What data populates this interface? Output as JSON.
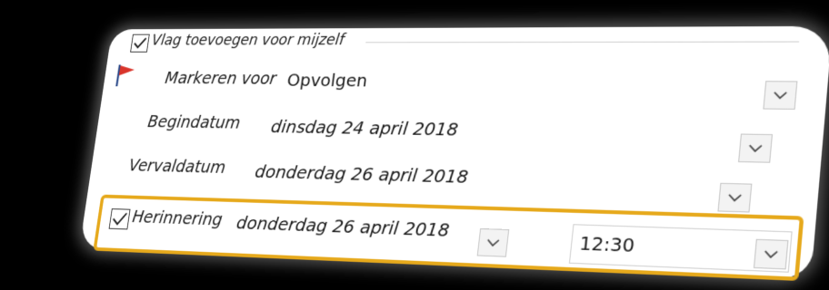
{
  "flag_group": {
    "checkbox_label": "Vlag toevoegen voor mijzelf",
    "checked": true
  },
  "icons": {
    "flag": "red-flag-icon",
    "dropdown": "chevron-down-icon",
    "checkmark": "checkmark-icon"
  },
  "fields": {
    "markeren_voor": {
      "label": "Markeren voor",
      "value": "Opvolgen"
    },
    "begindatum": {
      "label": "Begindatum",
      "value": "dinsdag 24 april 2018"
    },
    "vervaldatum": {
      "label": "Vervaldatum",
      "value": "donderdag 26 april 2018"
    },
    "herinnering": {
      "label": "Herinnering",
      "checked": true,
      "date_value": "donderdag 26 april 2018",
      "time_value": "12:30"
    }
  },
  "colors": {
    "highlight": "#e6a91c",
    "flag_red": "#d9342b",
    "background": "#000000"
  }
}
